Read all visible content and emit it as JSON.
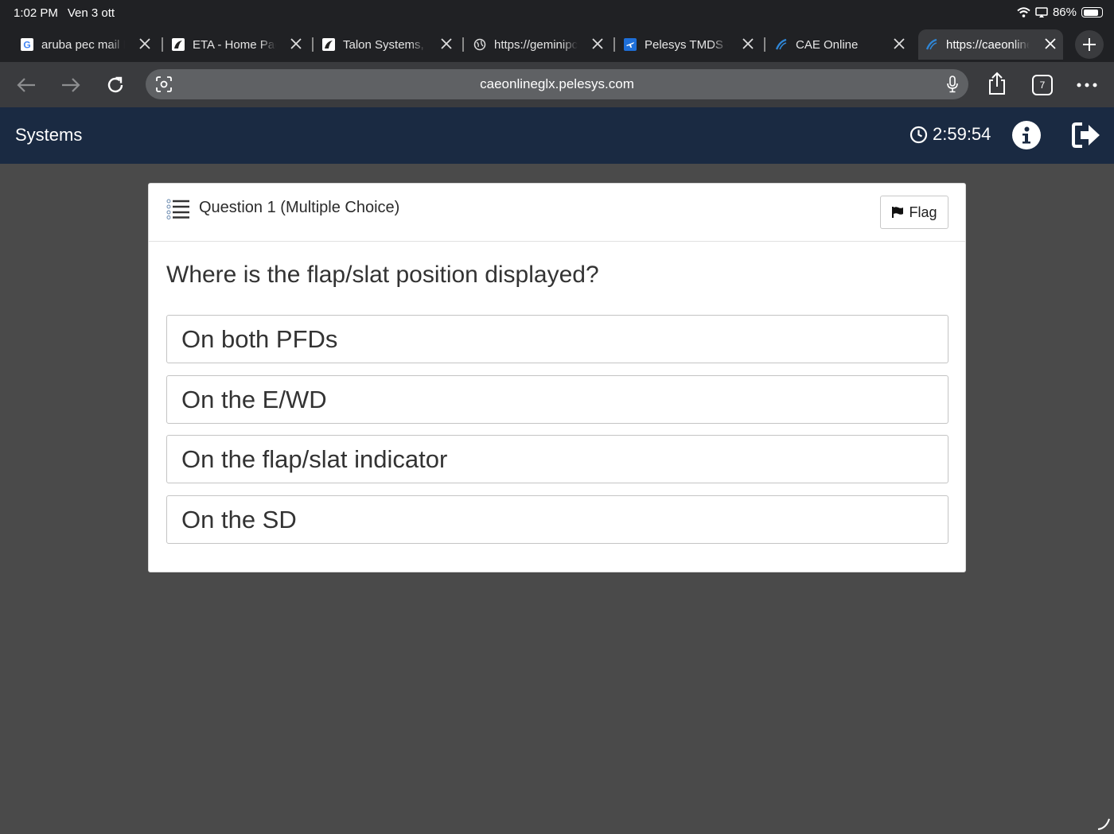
{
  "status_bar": {
    "time": "1:02 PM",
    "date": "Ven 3 ott",
    "battery": "86%",
    "battery_level": 0.86
  },
  "tabs": [
    {
      "title": "aruba pec mail I",
      "favicon": "google-icon"
    },
    {
      "title": "ETA - Home Pag",
      "favicon": "eta-icon"
    },
    {
      "title": "Talon Systems,",
      "favicon": "talon-icon"
    },
    {
      "title": "https://geminipc",
      "favicon": "globe-icon"
    },
    {
      "title": "Pelesys TMDS -",
      "favicon": "plane-icon"
    },
    {
      "title": "CAE Online",
      "favicon": "cae-icon"
    },
    {
      "title": "https://caeonline",
      "favicon": "cae-icon",
      "active": true
    }
  ],
  "toolbar": {
    "url": "caeonlineglx.pelesys.com",
    "tab_count": "7"
  },
  "header": {
    "title": "Systems",
    "timer": "2:59:54"
  },
  "question": {
    "label": "Question 1 (Multiple Choice)",
    "flag_label": "Flag",
    "text": "Where is the flap/slat position displayed?",
    "options": [
      "On both PFDs",
      "On the E/WD",
      "On the flap/slat indicator",
      "On the SD"
    ]
  },
  "colors": {
    "header_bg": "#1a2a42",
    "page_bg": "#4a4a4a",
    "chrome_bg": "#202124"
  }
}
